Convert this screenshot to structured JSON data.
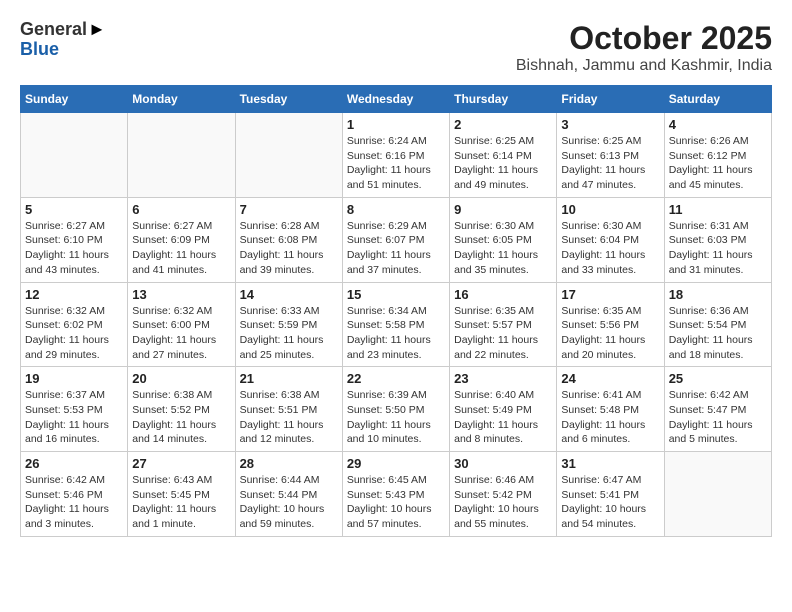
{
  "header": {
    "logo_general": "General",
    "logo_blue": "Blue",
    "title": "October 2025",
    "subtitle": "Bishnah, Jammu and Kashmir, India"
  },
  "days_of_week": [
    "Sunday",
    "Monday",
    "Tuesday",
    "Wednesday",
    "Thursday",
    "Friday",
    "Saturday"
  ],
  "weeks": [
    [
      {
        "day": "",
        "info": ""
      },
      {
        "day": "",
        "info": ""
      },
      {
        "day": "",
        "info": ""
      },
      {
        "day": "1",
        "info": "Sunrise: 6:24 AM\nSunset: 6:16 PM\nDaylight: 11 hours and 51 minutes."
      },
      {
        "day": "2",
        "info": "Sunrise: 6:25 AM\nSunset: 6:14 PM\nDaylight: 11 hours and 49 minutes."
      },
      {
        "day": "3",
        "info": "Sunrise: 6:25 AM\nSunset: 6:13 PM\nDaylight: 11 hours and 47 minutes."
      },
      {
        "day": "4",
        "info": "Sunrise: 6:26 AM\nSunset: 6:12 PM\nDaylight: 11 hours and 45 minutes."
      }
    ],
    [
      {
        "day": "5",
        "info": "Sunrise: 6:27 AM\nSunset: 6:10 PM\nDaylight: 11 hours and 43 minutes."
      },
      {
        "day": "6",
        "info": "Sunrise: 6:27 AM\nSunset: 6:09 PM\nDaylight: 11 hours and 41 minutes."
      },
      {
        "day": "7",
        "info": "Sunrise: 6:28 AM\nSunset: 6:08 PM\nDaylight: 11 hours and 39 minutes."
      },
      {
        "day": "8",
        "info": "Sunrise: 6:29 AM\nSunset: 6:07 PM\nDaylight: 11 hours and 37 minutes."
      },
      {
        "day": "9",
        "info": "Sunrise: 6:30 AM\nSunset: 6:05 PM\nDaylight: 11 hours and 35 minutes."
      },
      {
        "day": "10",
        "info": "Sunrise: 6:30 AM\nSunset: 6:04 PM\nDaylight: 11 hours and 33 minutes."
      },
      {
        "day": "11",
        "info": "Sunrise: 6:31 AM\nSunset: 6:03 PM\nDaylight: 11 hours and 31 minutes."
      }
    ],
    [
      {
        "day": "12",
        "info": "Sunrise: 6:32 AM\nSunset: 6:02 PM\nDaylight: 11 hours and 29 minutes."
      },
      {
        "day": "13",
        "info": "Sunrise: 6:32 AM\nSunset: 6:00 PM\nDaylight: 11 hours and 27 minutes."
      },
      {
        "day": "14",
        "info": "Sunrise: 6:33 AM\nSunset: 5:59 PM\nDaylight: 11 hours and 25 minutes."
      },
      {
        "day": "15",
        "info": "Sunrise: 6:34 AM\nSunset: 5:58 PM\nDaylight: 11 hours and 23 minutes."
      },
      {
        "day": "16",
        "info": "Sunrise: 6:35 AM\nSunset: 5:57 PM\nDaylight: 11 hours and 22 minutes."
      },
      {
        "day": "17",
        "info": "Sunrise: 6:35 AM\nSunset: 5:56 PM\nDaylight: 11 hours and 20 minutes."
      },
      {
        "day": "18",
        "info": "Sunrise: 6:36 AM\nSunset: 5:54 PM\nDaylight: 11 hours and 18 minutes."
      }
    ],
    [
      {
        "day": "19",
        "info": "Sunrise: 6:37 AM\nSunset: 5:53 PM\nDaylight: 11 hours and 16 minutes."
      },
      {
        "day": "20",
        "info": "Sunrise: 6:38 AM\nSunset: 5:52 PM\nDaylight: 11 hours and 14 minutes."
      },
      {
        "day": "21",
        "info": "Sunrise: 6:38 AM\nSunset: 5:51 PM\nDaylight: 11 hours and 12 minutes."
      },
      {
        "day": "22",
        "info": "Sunrise: 6:39 AM\nSunset: 5:50 PM\nDaylight: 11 hours and 10 minutes."
      },
      {
        "day": "23",
        "info": "Sunrise: 6:40 AM\nSunset: 5:49 PM\nDaylight: 11 hours and 8 minutes."
      },
      {
        "day": "24",
        "info": "Sunrise: 6:41 AM\nSunset: 5:48 PM\nDaylight: 11 hours and 6 minutes."
      },
      {
        "day": "25",
        "info": "Sunrise: 6:42 AM\nSunset: 5:47 PM\nDaylight: 11 hours and 5 minutes."
      }
    ],
    [
      {
        "day": "26",
        "info": "Sunrise: 6:42 AM\nSunset: 5:46 PM\nDaylight: 11 hours and 3 minutes."
      },
      {
        "day": "27",
        "info": "Sunrise: 6:43 AM\nSunset: 5:45 PM\nDaylight: 11 hours and 1 minute."
      },
      {
        "day": "28",
        "info": "Sunrise: 6:44 AM\nSunset: 5:44 PM\nDaylight: 10 hours and 59 minutes."
      },
      {
        "day": "29",
        "info": "Sunrise: 6:45 AM\nSunset: 5:43 PM\nDaylight: 10 hours and 57 minutes."
      },
      {
        "day": "30",
        "info": "Sunrise: 6:46 AM\nSunset: 5:42 PM\nDaylight: 10 hours and 55 minutes."
      },
      {
        "day": "31",
        "info": "Sunrise: 6:47 AM\nSunset: 5:41 PM\nDaylight: 10 hours and 54 minutes."
      },
      {
        "day": "",
        "info": ""
      }
    ]
  ]
}
